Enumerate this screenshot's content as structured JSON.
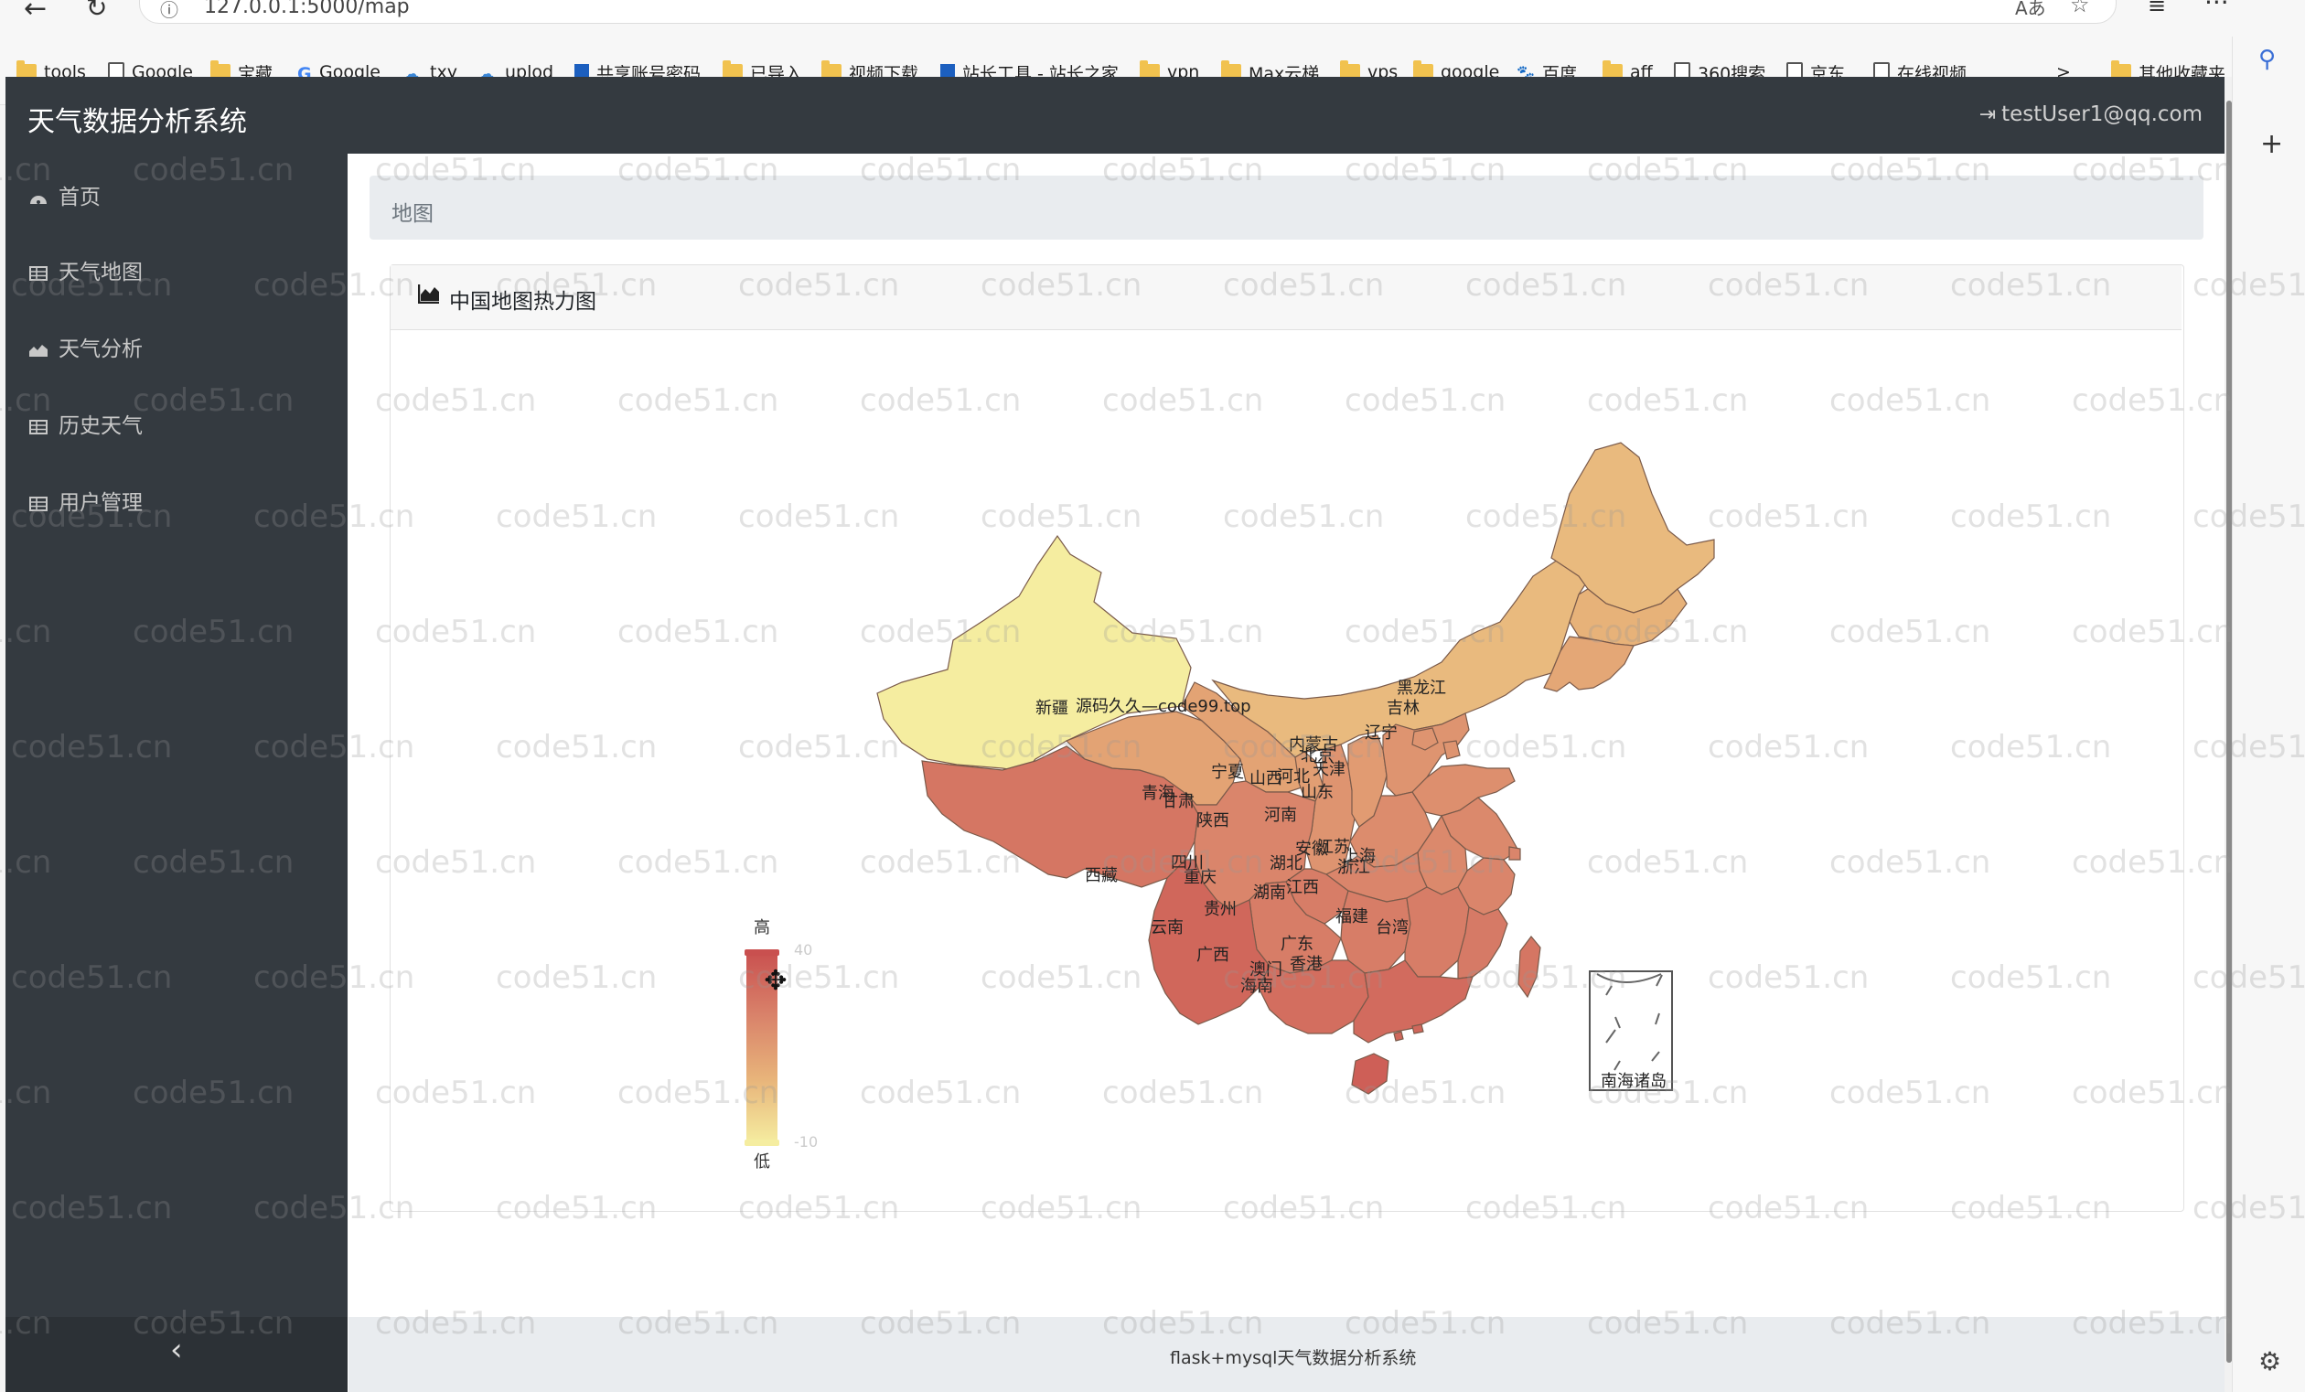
{
  "browser": {
    "url": "127.0.0.1:5000/map",
    "bookmarks": [
      {
        "label": "tools",
        "type": "folder"
      },
      {
        "label": "Google",
        "type": "page"
      },
      {
        "label": "宝藏",
        "type": "folder"
      },
      {
        "label": "Google",
        "type": "google"
      },
      {
        "label": "txy",
        "type": "cloud"
      },
      {
        "label": "uplod",
        "type": "cloud"
      },
      {
        "label": "共享账号密码",
        "type": "link"
      },
      {
        "label": "已导入",
        "type": "folder"
      },
      {
        "label": "视频下载",
        "type": "folder"
      },
      {
        "label": "站长工具 - 站长之家",
        "type": "link"
      },
      {
        "label": "vpn",
        "type": "folder"
      },
      {
        "label": "Max云梯",
        "type": "folder"
      },
      {
        "label": "vps",
        "type": "folder"
      },
      {
        "label": "google",
        "type": "folder"
      },
      {
        "label": "百度",
        "type": "baidu"
      },
      {
        "label": "aff",
        "type": "folder"
      },
      {
        "label": "360搜索",
        "type": "page"
      },
      {
        "label": "京东",
        "type": "page"
      },
      {
        "label": "在线视频",
        "type": "page"
      },
      {
        "label": ">",
        "type": "more"
      },
      {
        "label": "其他收藏夹",
        "type": "folder"
      }
    ]
  },
  "app": {
    "title": "天气数据分析系统",
    "user": "testUser1@qq.com",
    "sidebar": [
      {
        "label": "首页",
        "icon": "dashboard-icon"
      },
      {
        "label": "天气地图",
        "icon": "table-icon"
      },
      {
        "label": "天气分析",
        "icon": "area-chart-icon"
      },
      {
        "label": "历史天气",
        "icon": "table-icon"
      },
      {
        "label": "用户管理",
        "icon": "table-icon"
      }
    ],
    "collapse_label": "‹",
    "breadcrumb": "地图",
    "card_title": "中国地图热力图",
    "footer": "flask+mysql天气数据分析系统",
    "watermark": "code51.cn",
    "map_overlay_text": "源码久久—code99.top"
  },
  "chart_data": {
    "type": "heatmap",
    "visual_map": {
      "max_label": "高",
      "min_label": "低",
      "max_value": 40,
      "min_value": -10,
      "colors": [
        "#f5eda0",
        "#e8b47a",
        "#d9826a",
        "#c9504f"
      ]
    },
    "regions": [
      {
        "name": "新疆",
        "level": 0.0
      },
      {
        "name": "西藏",
        "level": 0.75
      },
      {
        "name": "青海",
        "level": 0.45
      },
      {
        "name": "甘肃",
        "level": 0.45
      },
      {
        "name": "内蒙古",
        "level": 0.3
      },
      {
        "name": "黑龙江",
        "level": 0.3
      },
      {
        "name": "吉林",
        "level": 0.35
      },
      {
        "name": "辽宁",
        "level": 0.42
      },
      {
        "name": "宁夏",
        "level": 0.48
      },
      {
        "name": "陕西",
        "level": 0.55
      },
      {
        "name": "山西",
        "level": 0.5
      },
      {
        "name": "河北",
        "level": 0.55
      },
      {
        "name": "北京",
        "level": 0.55
      },
      {
        "name": "天津",
        "level": 0.55
      },
      {
        "name": "山东",
        "level": 0.58
      },
      {
        "name": "河南",
        "level": 0.6
      },
      {
        "name": "江苏",
        "level": 0.62
      },
      {
        "name": "安徽",
        "level": 0.62
      },
      {
        "name": "上海",
        "level": 0.65
      },
      {
        "name": "浙江",
        "level": 0.65
      },
      {
        "name": "湖北",
        "level": 0.65
      },
      {
        "name": "四川",
        "level": 0.65
      },
      {
        "name": "重庆",
        "level": 0.7
      },
      {
        "name": "湖南",
        "level": 0.7
      },
      {
        "name": "江西",
        "level": 0.7
      },
      {
        "name": "贵州",
        "level": 0.7
      },
      {
        "name": "云南",
        "level": 0.85
      },
      {
        "name": "福建",
        "level": 0.72
      },
      {
        "name": "台湾",
        "level": 0.75
      },
      {
        "name": "广西",
        "level": 0.8
      },
      {
        "name": "广东",
        "level": 0.82
      },
      {
        "name": "香港",
        "level": 0.85
      },
      {
        "name": "澳门",
        "level": 0.85
      },
      {
        "name": "海南",
        "level": 0.9
      },
      {
        "name": "南海诸岛",
        "level": null
      }
    ]
  }
}
